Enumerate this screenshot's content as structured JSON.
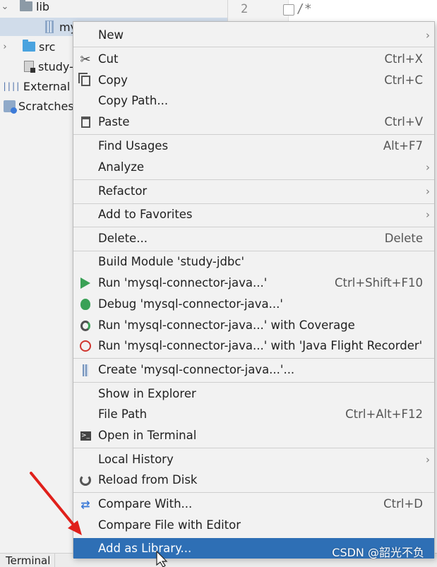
{
  "tree": {
    "lib_label": "lib",
    "jar_label": "my",
    "src_label": "src",
    "iml_label": "study-",
    "external_label": "External L",
    "scratches_label": "Scratches"
  },
  "editor": {
    "line_number": "2",
    "code_text": "/*"
  },
  "menu": {
    "items": [
      {
        "label": "New",
        "shortcut": ""
      },
      {
        "label": "Cut",
        "shortcut": "Ctrl+X"
      },
      {
        "label": "Copy",
        "shortcut": "Ctrl+C"
      },
      {
        "label": "Copy Path...",
        "shortcut": ""
      },
      {
        "label": "Paste",
        "shortcut": "Ctrl+V"
      },
      {
        "label": "Find Usages",
        "shortcut": "Alt+F7"
      },
      {
        "label": "Analyze",
        "shortcut": ""
      },
      {
        "label": "Refactor",
        "shortcut": ""
      },
      {
        "label": "Add to Favorites",
        "shortcut": ""
      },
      {
        "label": "Delete...",
        "shortcut": "Delete"
      },
      {
        "label": "Build Module 'study-jdbc'",
        "shortcut": ""
      },
      {
        "label": "Run 'mysql-connector-java...'",
        "shortcut": "Ctrl+Shift+F10"
      },
      {
        "label": "Debug 'mysql-connector-java...'",
        "shortcut": ""
      },
      {
        "label": "Run 'mysql-connector-java...' with Coverage",
        "shortcut": ""
      },
      {
        "label": "Run 'mysql-connector-java...' with 'Java Flight Recorder'",
        "shortcut": ""
      },
      {
        "label": "Create 'mysql-connector-java...'...",
        "shortcut": ""
      },
      {
        "label": "Show in Explorer",
        "shortcut": ""
      },
      {
        "label": "File Path",
        "shortcut": "Ctrl+Alt+F12"
      },
      {
        "label": "Open in Terminal",
        "shortcut": ""
      },
      {
        "label": "Local History",
        "shortcut": ""
      },
      {
        "label": "Reload from Disk",
        "shortcut": ""
      },
      {
        "label": "Compare With...",
        "shortcut": "Ctrl+D"
      },
      {
        "label": "Compare File with Editor",
        "shortcut": ""
      },
      {
        "label": "Add as Library...",
        "shortcut": ""
      }
    ]
  },
  "bottom": {
    "terminal_label": "Terminal",
    "watermark": "CSDN @韶光不负"
  },
  "colors": {
    "highlight": "#2e6fb5",
    "annotation_arrow": "#e0201b"
  },
  "annotation": {
    "arrow_icon": "red-arrow-pointing-to-add-as-library"
  }
}
